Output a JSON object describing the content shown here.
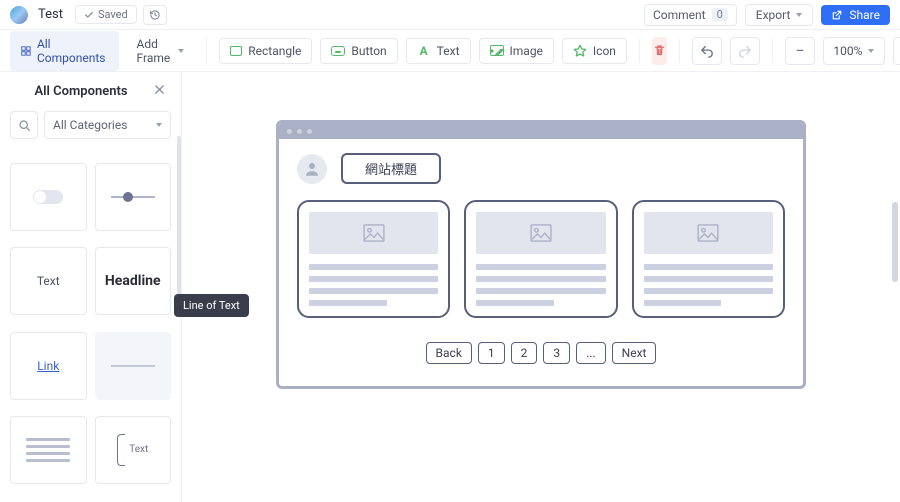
{
  "topbar": {
    "doc_title": "Test",
    "saved_label": "Saved",
    "comment_label": "Comment",
    "comment_count": "0",
    "export_label": "Export",
    "share_label": "Share"
  },
  "toolbar": {
    "all_components": "All Components",
    "add_frame": "Add Frame",
    "rectangle": "Rectangle",
    "button": "Button",
    "text": "Text",
    "image": "Image",
    "icon": "Icon",
    "zoom": "100%",
    "options": "Options"
  },
  "sidebar": {
    "title": "All Components",
    "category_label": "All Categories",
    "components": {
      "text": "Text",
      "headline": "Headline",
      "link": "Link",
      "annotation_text": "Text"
    },
    "tooltip": "Line of Text"
  },
  "mockup": {
    "site_title": "網站標題",
    "pager": {
      "back": "Back",
      "p1": "1",
      "p2": "2",
      "p3": "3",
      "ellipsis": "...",
      "next": "Next"
    }
  }
}
